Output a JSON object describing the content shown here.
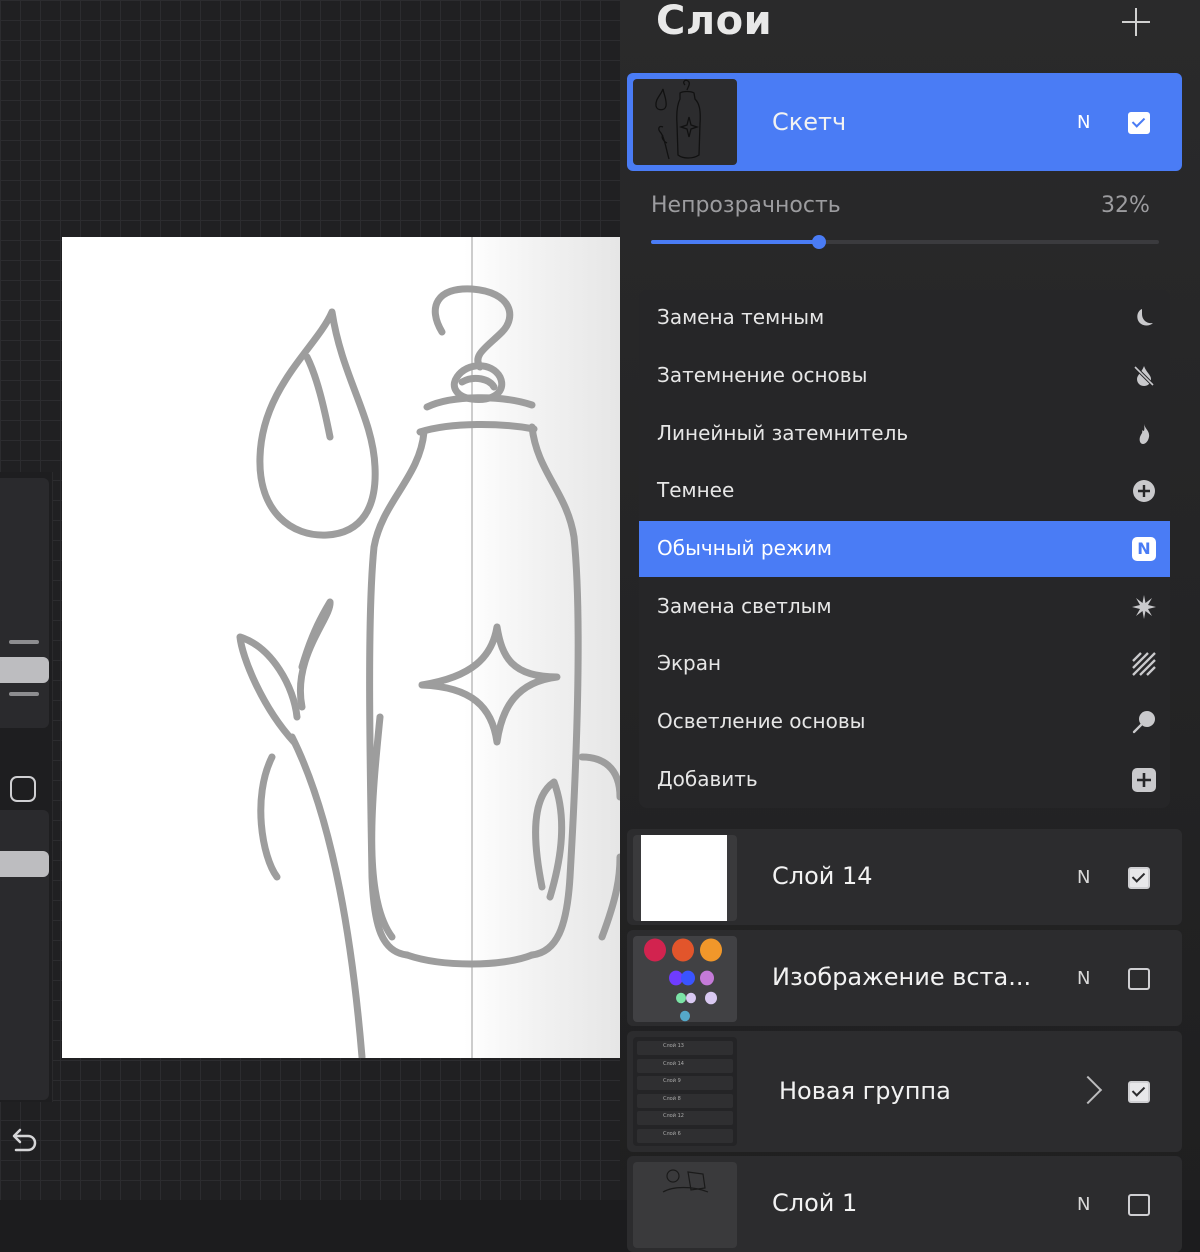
{
  "panel": {
    "title": "Слои",
    "add_icon": "plus-icon"
  },
  "active_layer": {
    "name": "Скетч",
    "mode": "N",
    "visible": true
  },
  "opacity": {
    "label": "Непрозрачность",
    "value_text": "32%",
    "value": 0.32
  },
  "blend_modes": [
    {
      "label": "Замена темным",
      "icon": "moon-icon",
      "selected": false
    },
    {
      "label": "Затемнение основы",
      "icon": "burn-off-icon",
      "selected": false
    },
    {
      "label": "Линейный затемнитель",
      "icon": "flame-icon",
      "selected": false
    },
    {
      "label": "Темнее",
      "icon": "plus-circle-icon",
      "selected": false
    },
    {
      "label": "Обычный режим",
      "icon": "n-badge-icon",
      "badge": "N",
      "selected": true
    },
    {
      "label": "Замена светлым",
      "icon": "sparkle-burst-icon",
      "selected": false
    },
    {
      "label": "Экран",
      "icon": "hatch-icon",
      "selected": false
    },
    {
      "label": "Осветление основы",
      "icon": "lollipop-icon",
      "selected": false
    },
    {
      "label": "Добавить",
      "icon": "plus-square-icon",
      "selected": false
    }
  ],
  "layers": [
    {
      "name": "Слой 14",
      "mode": "N",
      "visible": true
    },
    {
      "name": "Изображение вста...",
      "mode": "N",
      "visible": false
    },
    {
      "name": "Новая группа",
      "visible": true,
      "is_group": true
    },
    {
      "name": "Слой 1",
      "mode": "N",
      "visible": false
    }
  ],
  "group_thumb_rows": [
    "Слой 13",
    "Слой 14",
    "Слой 9",
    "Слой 8",
    "Слой 12",
    "Слой 6"
  ],
  "colors": {
    "accent": "#4a7cf5",
    "panel_bg": "#2a2a2b",
    "swatches": [
      "#d2234f",
      "#e2552b",
      "#f1972a",
      "#6f3cff",
      "#3a54ff",
      "#c47ad8",
      "#7be3a6",
      "#d9c9f2",
      "#55a8c9"
    ]
  }
}
